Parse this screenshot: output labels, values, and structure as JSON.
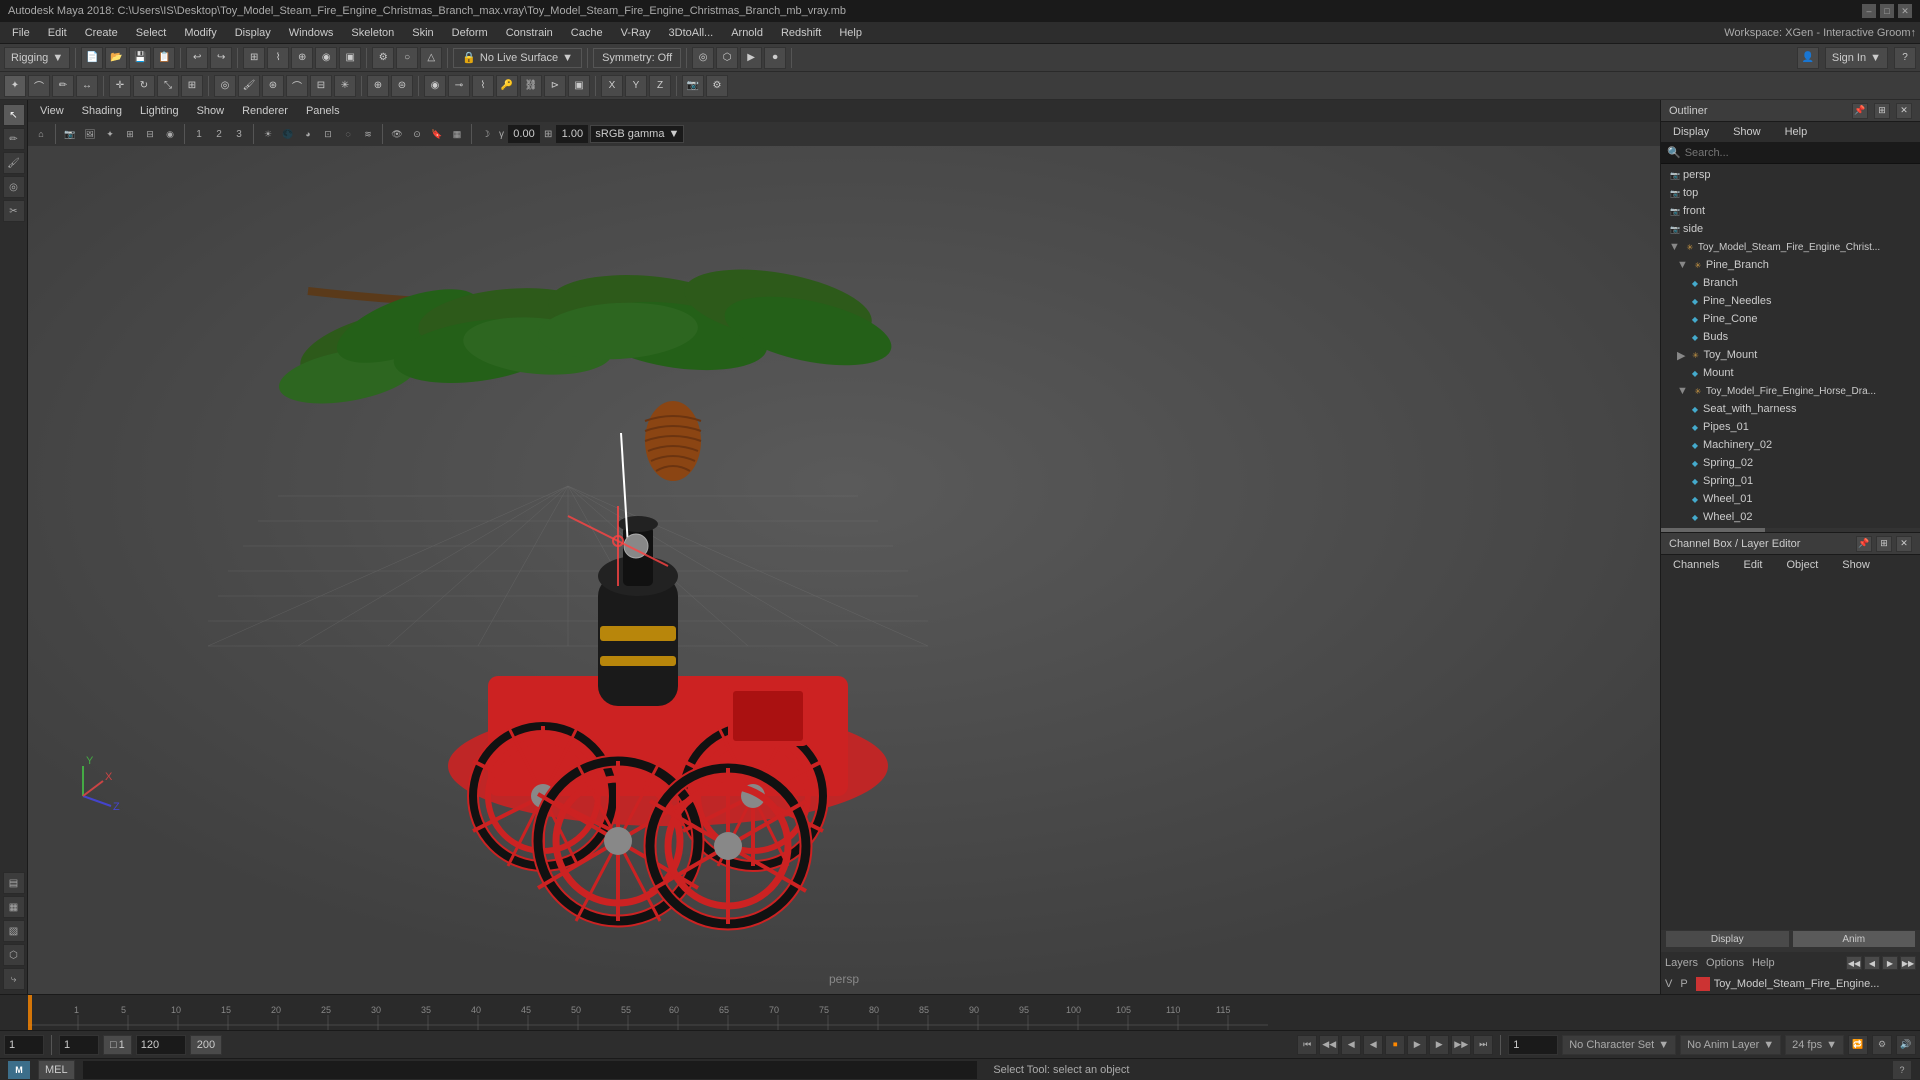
{
  "title_bar": {
    "title": "Autodesk Maya 2018: C:\\Users\\IS\\Desktop\\Toy_Model_Steam_Fire_Engine_Christmas_Branch_max.vray\\Toy_Model_Steam_Fire_Engine_Christmas_Branch_mb_vray.mb",
    "minimize": "–",
    "maximize": "□",
    "close": "✕"
  },
  "menu": {
    "workspace_label": "Workspace: XGen - Interactive Groom↑",
    "items": [
      "File",
      "Edit",
      "Create",
      "Select",
      "Modify",
      "Display",
      "Windows",
      "Skeleton",
      "Skin",
      "Deform",
      "Constrain",
      "Cache",
      "V-Ray",
      "3DtoAll...",
      "Arnold",
      "Redshift",
      "Help"
    ]
  },
  "toolbar1": {
    "rigging_label": "Rigging",
    "no_live_surface": "No Live Surface",
    "symmetry_off": "Symmetry: Off",
    "sign_in": "Sign In"
  },
  "viewport": {
    "view_menu": "View",
    "shading_menu": "Shading",
    "lighting_menu": "Lighting",
    "show_menu": "Show",
    "renderer_menu": "Renderer",
    "panels_menu": "Panels",
    "label": "persp",
    "gamma_value": "0.00",
    "gain_value": "1.00",
    "color_mode": "sRGB gamma"
  },
  "outliner": {
    "header": "Outliner",
    "menu_items": [
      "Display",
      "Show",
      "Help"
    ],
    "search_placeholder": "Search...",
    "tree_items": [
      {
        "label": "persp",
        "indent": 0,
        "type": "cam",
        "icon": "📷"
      },
      {
        "label": "top",
        "indent": 0,
        "type": "cam",
        "icon": "📷"
      },
      {
        "label": "front",
        "indent": 0,
        "type": "cam",
        "icon": "📷"
      },
      {
        "label": "side",
        "indent": 0,
        "type": "cam",
        "icon": "📷"
      },
      {
        "label": "Toy_Model_Steam_Fire_Engine_Christ...",
        "indent": 0,
        "type": "group",
        "icon": "▶"
      },
      {
        "label": "Pine_Branch",
        "indent": 1,
        "type": "group",
        "icon": "✳"
      },
      {
        "label": "Branch",
        "indent": 2,
        "type": "mesh",
        "icon": "◆"
      },
      {
        "label": "Pine_Needles",
        "indent": 2,
        "type": "mesh",
        "icon": "◆"
      },
      {
        "label": "Pine_Cone",
        "indent": 2,
        "type": "mesh",
        "icon": "◆"
      },
      {
        "label": "Buds",
        "indent": 2,
        "type": "mesh",
        "icon": "◆"
      },
      {
        "label": "Toy_Mount",
        "indent": 1,
        "type": "group",
        "icon": "▶"
      },
      {
        "label": "Mount",
        "indent": 2,
        "type": "mesh",
        "icon": "◆"
      },
      {
        "label": "Toy_Model_Fire_Engine_Horse_Dra...",
        "indent": 1,
        "type": "group",
        "icon": "▶"
      },
      {
        "label": "Seat_with_harness",
        "indent": 2,
        "type": "mesh",
        "icon": "◆"
      },
      {
        "label": "Pipes_01",
        "indent": 2,
        "type": "mesh",
        "icon": "◆"
      },
      {
        "label": "Machinery_02",
        "indent": 2,
        "type": "mesh",
        "icon": "◆"
      },
      {
        "label": "Spring_02",
        "indent": 2,
        "type": "mesh",
        "icon": "◆"
      },
      {
        "label": "Spring_01",
        "indent": 2,
        "type": "mesh",
        "icon": "◆"
      },
      {
        "label": "Wheel_01",
        "indent": 2,
        "type": "mesh",
        "icon": "◆"
      },
      {
        "label": "Wheel_02",
        "indent": 2,
        "type": "mesh",
        "icon": "◆"
      }
    ]
  },
  "channel_box": {
    "header": "Channel Box / Layer Editor",
    "menu_items": [
      "Channels",
      "Edit",
      "Object",
      "Show"
    ],
    "tabs": [
      "Display",
      "Anim"
    ],
    "sub_menu": [
      "Layers",
      "Options",
      "Help"
    ],
    "layer_label": "Toy_Model_Steam_Fire_Engine...",
    "layer_color": "#cc3333",
    "layer_v": "V",
    "layer_p": "P"
  },
  "timeline": {
    "start_frame": "1",
    "end_frame": "120",
    "current_frame": "1",
    "range_start": "1",
    "range_end": "120",
    "fps": "24 fps",
    "anim_end": "200",
    "no_character_set": "No Character Set",
    "no_anim_layer": "No Anim Layer"
  },
  "playback": {
    "prev_key": "⏮",
    "step_back": "◀◀",
    "prev_frame": "◀",
    "play_back": "▶",
    "play_fwd": "▶",
    "next_frame": "▶",
    "step_fwd": "▶▶",
    "next_key": "⏭"
  },
  "status_bar": {
    "logo": "M",
    "script_type": "MEL",
    "message": "Select Tool: select an object"
  }
}
